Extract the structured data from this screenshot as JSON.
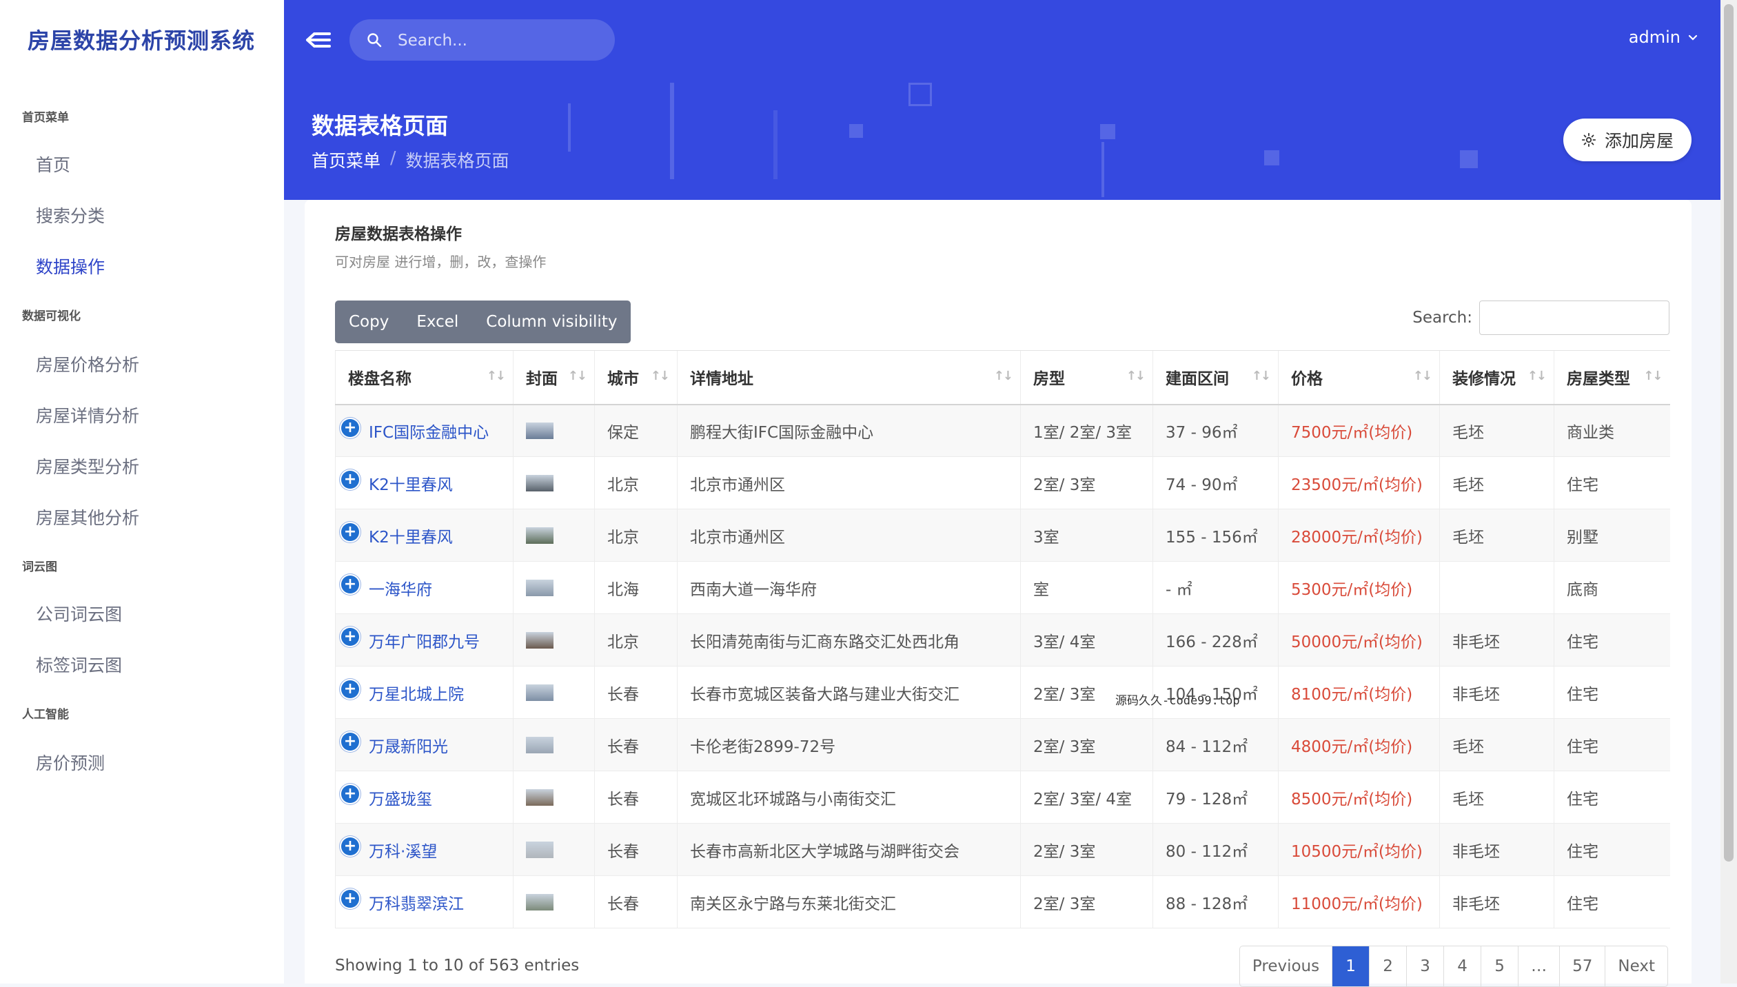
{
  "sidebar": {
    "brand": "房屋数据分析预测系统",
    "sections": [
      {
        "title": "首页菜单",
        "items": [
          "首页",
          "搜索分类",
          "数据操作"
        ]
      },
      {
        "title": "数据可视化",
        "items": [
          "房屋价格分析",
          "房屋详情分析",
          "房屋类型分析",
          "房屋其他分析"
        ]
      },
      {
        "title": "词云图",
        "items": [
          "公司词云图",
          "标签词云图"
        ]
      },
      {
        "title": "人工智能",
        "items": [
          "房价预测"
        ]
      }
    ],
    "active_item": "数据操作"
  },
  "header": {
    "search_placeholder": "Search...",
    "user": "admin",
    "page_title": "数据表格页面",
    "breadcrumb": [
      "首页菜单",
      "数据表格页面"
    ],
    "add_button": "添加房屋"
  },
  "card": {
    "title": "房屋数据表格操作",
    "subtitle": "可对房屋 进行增，删，改，查操作",
    "buttons": [
      "Copy",
      "Excel",
      "Column visibility"
    ],
    "search_label": "Search:"
  },
  "table": {
    "columns": [
      "楼盘名称",
      "封面",
      "城市",
      "详情地址",
      "房型",
      "建面区间",
      "价格",
      "装修情况",
      "房屋类型"
    ],
    "rows": [
      {
        "name": "IFC国际金融中心",
        "city": "保定",
        "address": "鹏程大街IFC国际金融中心",
        "layout": "1室/ 2室/ 3室",
        "area": "37 - 96㎡",
        "price": "7500元/㎡(均价)",
        "decor": "毛坯",
        "type": "商业类"
      },
      {
        "name": "K2十里春风",
        "city": "北京",
        "address": "北京市通州区",
        "layout": "2室/ 3室",
        "area": "74 - 90㎡",
        "price": "23500元/㎡(均价)",
        "decor": "毛坯",
        "type": "住宅"
      },
      {
        "name": "K2十里春风",
        "city": "北京",
        "address": "北京市通州区",
        "layout": "3室",
        "area": "155 - 156㎡",
        "price": "28000元/㎡(均价)",
        "decor": "毛坯",
        "type": "别墅"
      },
      {
        "name": "一海华府",
        "city": "北海",
        "address": "西南大道一海华府",
        "layout": "室",
        "area": "- ㎡",
        "price": "5300元/㎡(均价)",
        "decor": "",
        "type": "底商"
      },
      {
        "name": "万年广阳郡九号",
        "city": "北京",
        "address": "长阳清苑南街与汇商东路交汇处西北角",
        "layout": "3室/ 4室",
        "area": "166 - 228㎡",
        "price": "50000元/㎡(均价)",
        "decor": "非毛坯",
        "type": "住宅"
      },
      {
        "name": "万星北城上院",
        "city": "长春",
        "address": "长春市宽城区装备大路与建业大街交汇",
        "layout": "2室/ 3室",
        "area": "104 - 150㎡",
        "price": "8100元/㎡(均价)",
        "decor": "非毛坯",
        "type": "住宅"
      },
      {
        "name": "万晟新阳光",
        "city": "长春",
        "address": "卡伦老街2899-72号",
        "layout": "2室/ 3室",
        "area": "84 - 112㎡",
        "price": "4800元/㎡(均价)",
        "decor": "毛坯",
        "type": "住宅"
      },
      {
        "name": "万盛珑玺",
        "city": "长春",
        "address": "宽城区北环城路与小南街交汇",
        "layout": "2室/ 3室/ 4室",
        "area": "79 - 128㎡",
        "price": "8500元/㎡(均价)",
        "decor": "毛坯",
        "type": "住宅"
      },
      {
        "name": "万科·溪望",
        "city": "长春",
        "address": "长春市高新北区大学城路与湖畔街交会",
        "layout": "2室/ 3室",
        "area": "80 - 112㎡",
        "price": "10500元/㎡(均价)",
        "decor": "非毛坯",
        "type": "住宅"
      },
      {
        "name": "万科翡翠滨江",
        "city": "长春",
        "address": "南关区永宁路与东莱北街交汇",
        "layout": "2室/ 3室",
        "area": "88 - 128㎡",
        "price": "11000元/㎡(均价)",
        "decor": "非毛坯",
        "type": "住宅"
      }
    ]
  },
  "footer": {
    "info": "Showing 1 to 10 of 563 entries",
    "pages": [
      "Previous",
      "1",
      "2",
      "3",
      "4",
      "5",
      "…",
      "57",
      "Next"
    ],
    "current_page": "1"
  },
  "overlay_text": "源码久久-code99.top",
  "colors": {
    "header": "#3549e0",
    "brand": "#2c44a8",
    "link": "#2c55c8",
    "price": "#d94b3a",
    "pager_active": "#2e5fd4"
  }
}
